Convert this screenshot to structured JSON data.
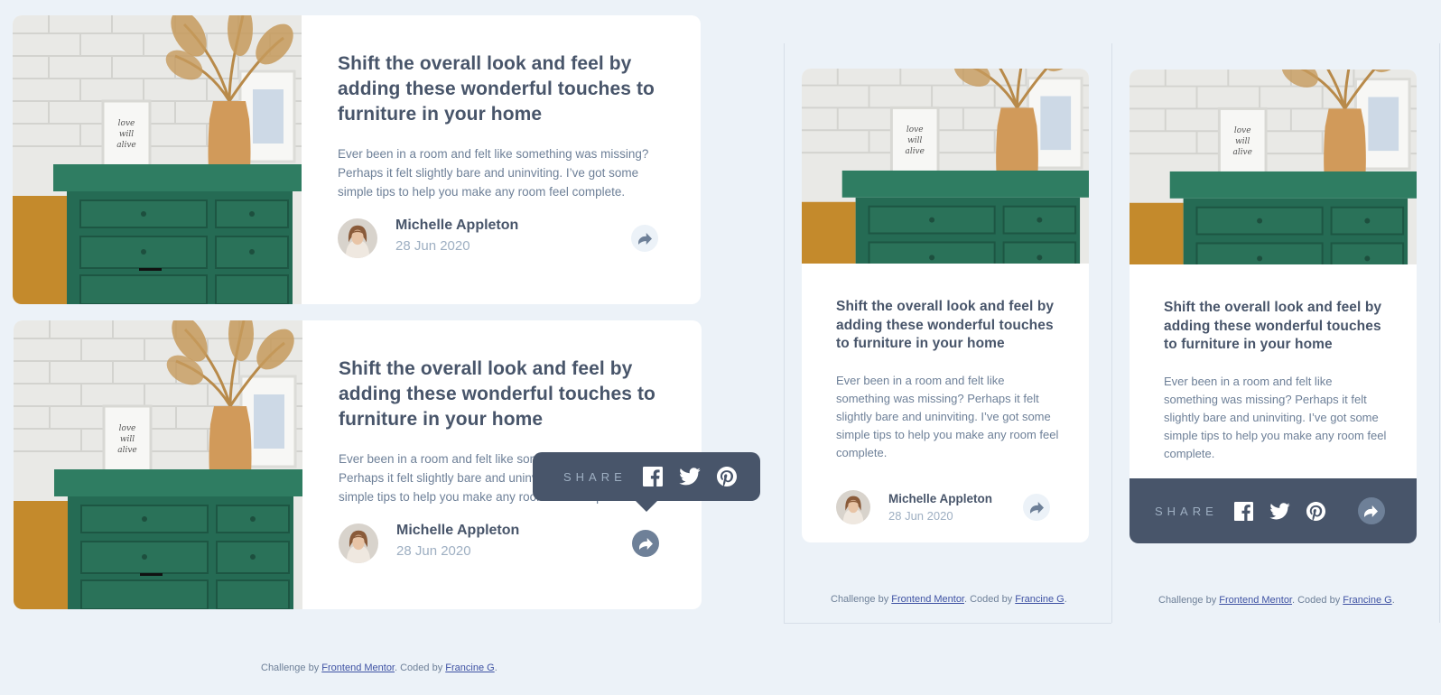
{
  "article": {
    "title": "Shift the overall look and feel by adding these wonderful touches to furniture in your home",
    "excerpt": "Ever been in a room and felt like something was missing? Perhaps it felt slightly bare and uninviting. I’ve got some simple tips to help you make any room feel complete.",
    "author": "Michelle Appleton",
    "date": "28 Jun 2020"
  },
  "share": {
    "label": "SHARE",
    "networks": [
      "facebook-icon",
      "twitter-icon",
      "pinterest-icon"
    ]
  },
  "attribution": {
    "prefix": "Challenge by ",
    "link1": "Frontend Mentor",
    "middle": ". Coded by ",
    "link2": "Francine G",
    "suffix": "."
  },
  "colors": {
    "background": "#ecf2f8",
    "card": "#ffffff",
    "dark_blue": "#48556a",
    "grayish_blue": "#6e8098",
    "light_grayish_blue": "#9eafc2",
    "link": "#3e52a3"
  }
}
